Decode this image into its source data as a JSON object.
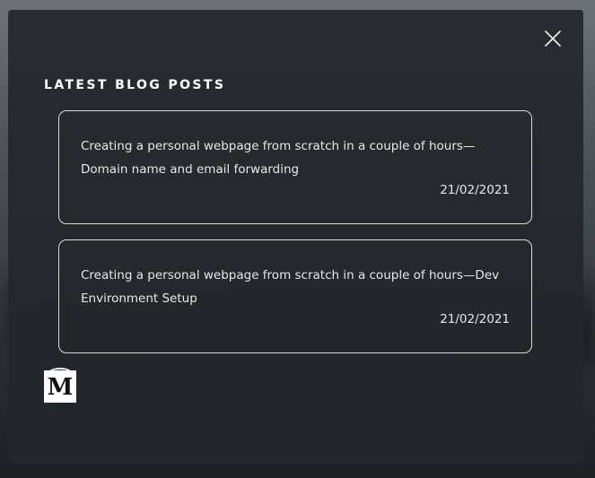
{
  "modal": {
    "section_title": "LATEST BLOG POSTS",
    "close_icon": "close-x-icon",
    "posts": [
      {
        "title": "Creating a personal webpage from scratch in a couple of hours—Domain name and email forwarding",
        "date": "21/02/2021"
      },
      {
        "title": "Creating a personal webpage from scratch in a couple of hours—Dev Environment Setup",
        "date": "21/02/2021"
      }
    ],
    "medium_logo": {
      "icon": "medium-logo-icon",
      "letter": "M"
    }
  },
  "colors": {
    "modal_background": "#24272c",
    "text": "#e6e8ea",
    "card_border": "#d8dadd",
    "logo_background": "#ffffff"
  }
}
